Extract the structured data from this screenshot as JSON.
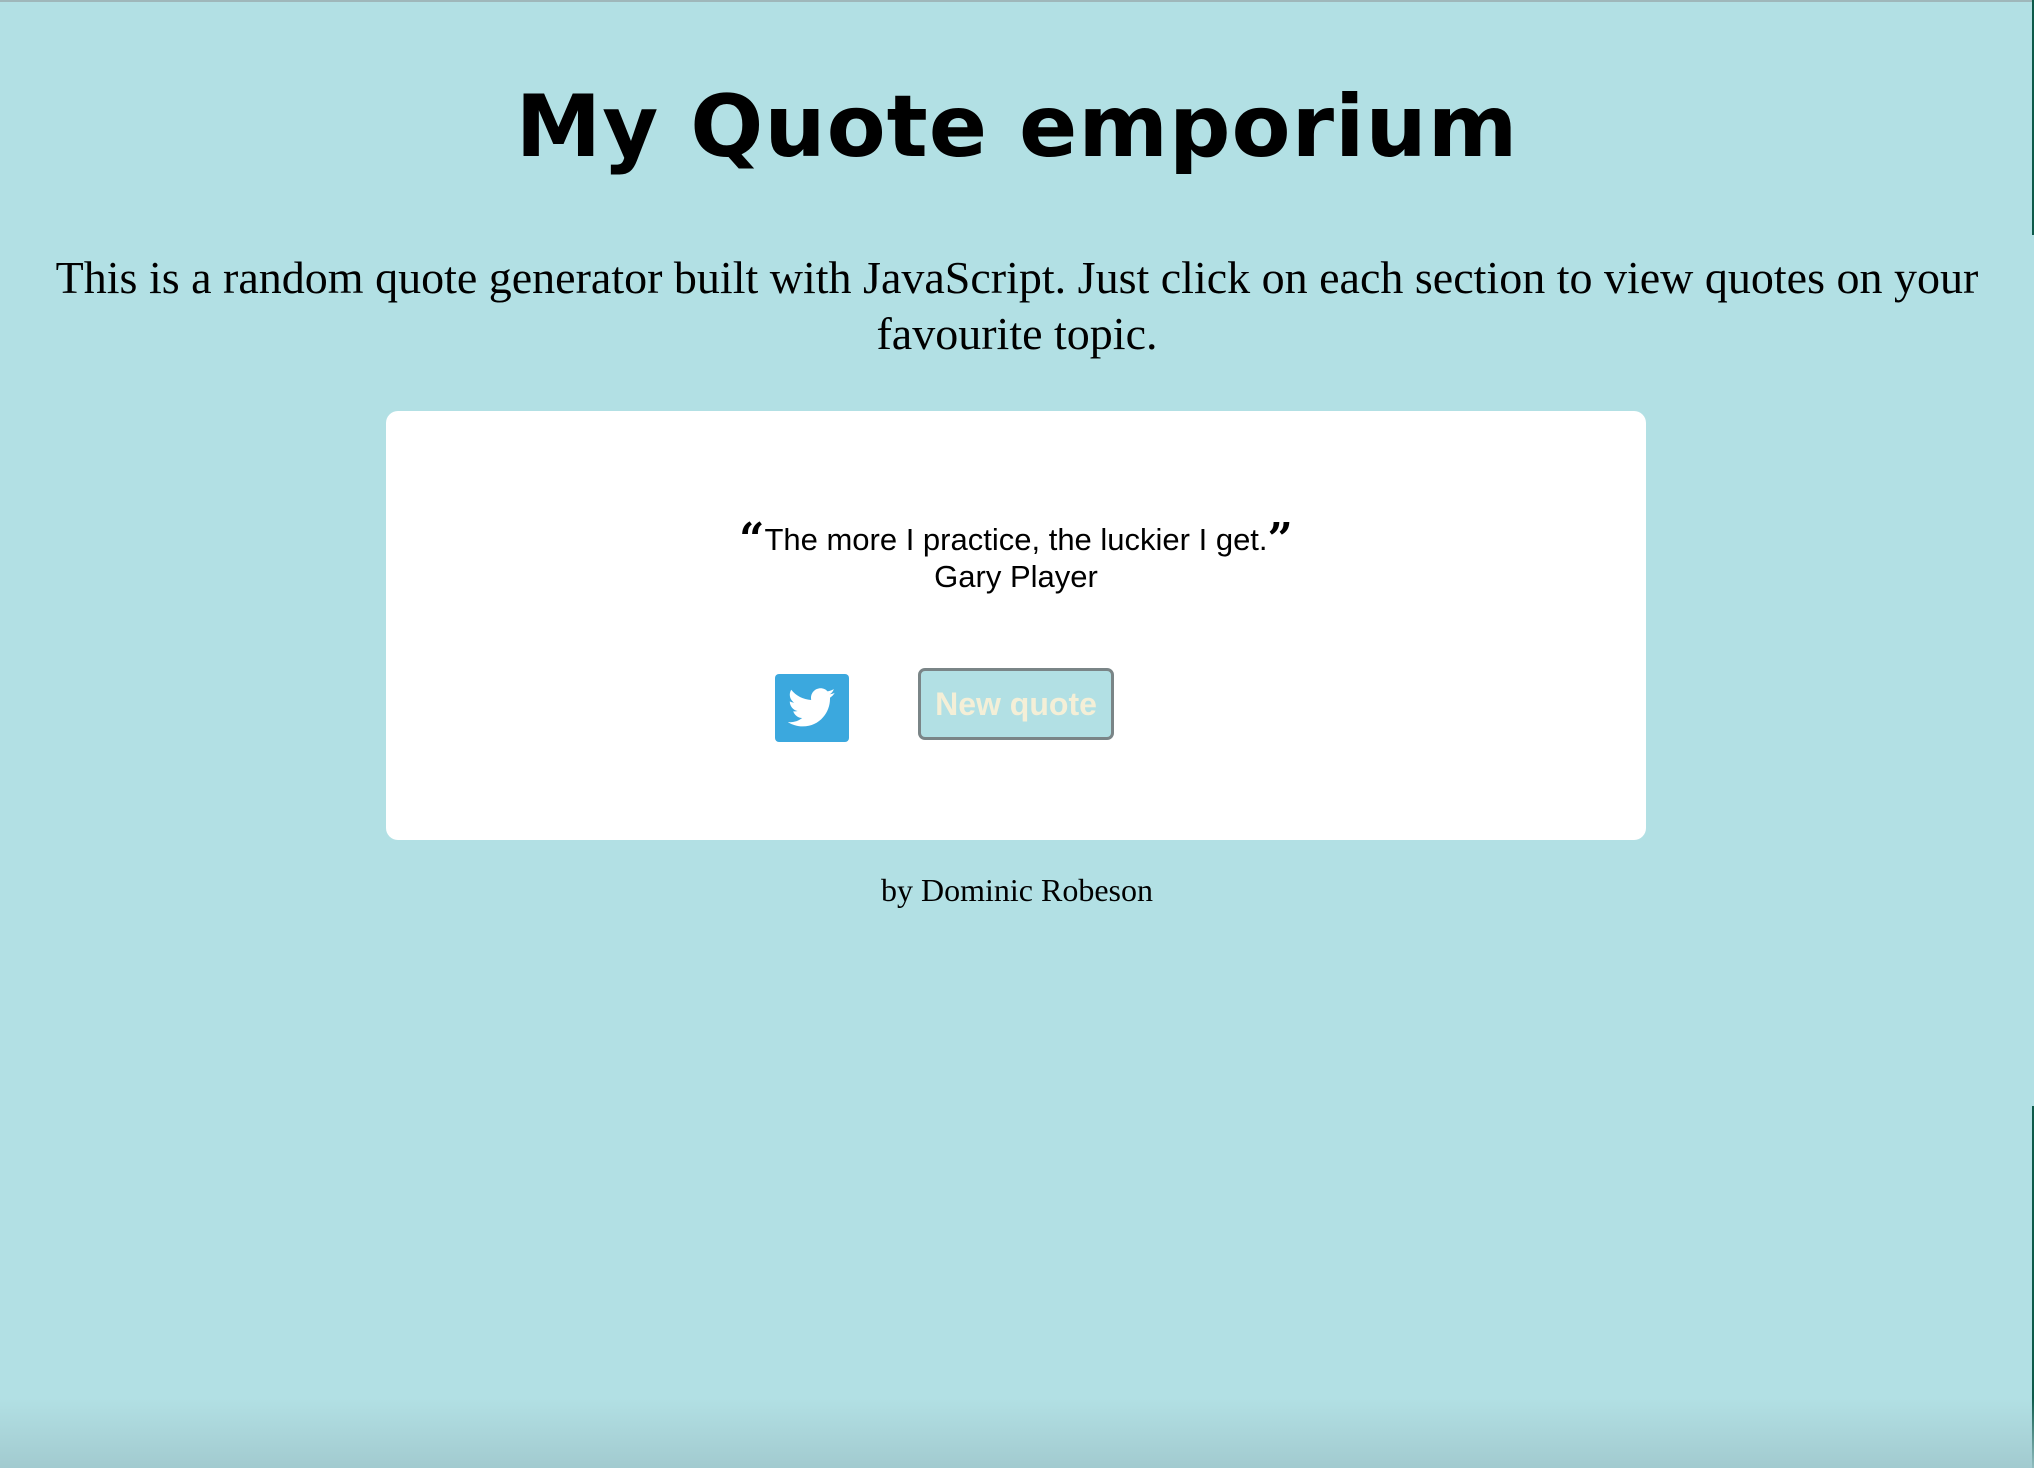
{
  "header": {
    "title": "My Quote emporium"
  },
  "intro": {
    "text": "This is a random quote generator built with JavaScript. Just click on each section to view quotes on your favourite topic."
  },
  "quote": {
    "open_mark": "“",
    "text": "The more I practice, the luckier I get.",
    "close_mark": "”",
    "author": "Gary Player"
  },
  "actions": {
    "twitter_icon": "twitter-bird-icon",
    "new_quote_label": "New quote"
  },
  "footer": {
    "credit": "by Dominic Robeson"
  },
  "colors": {
    "background": "#b2e0e4",
    "card": "#ffffff",
    "twitter": "#3ba8de",
    "button_text": "#f4efd7",
    "button_border": "#7a8587"
  }
}
